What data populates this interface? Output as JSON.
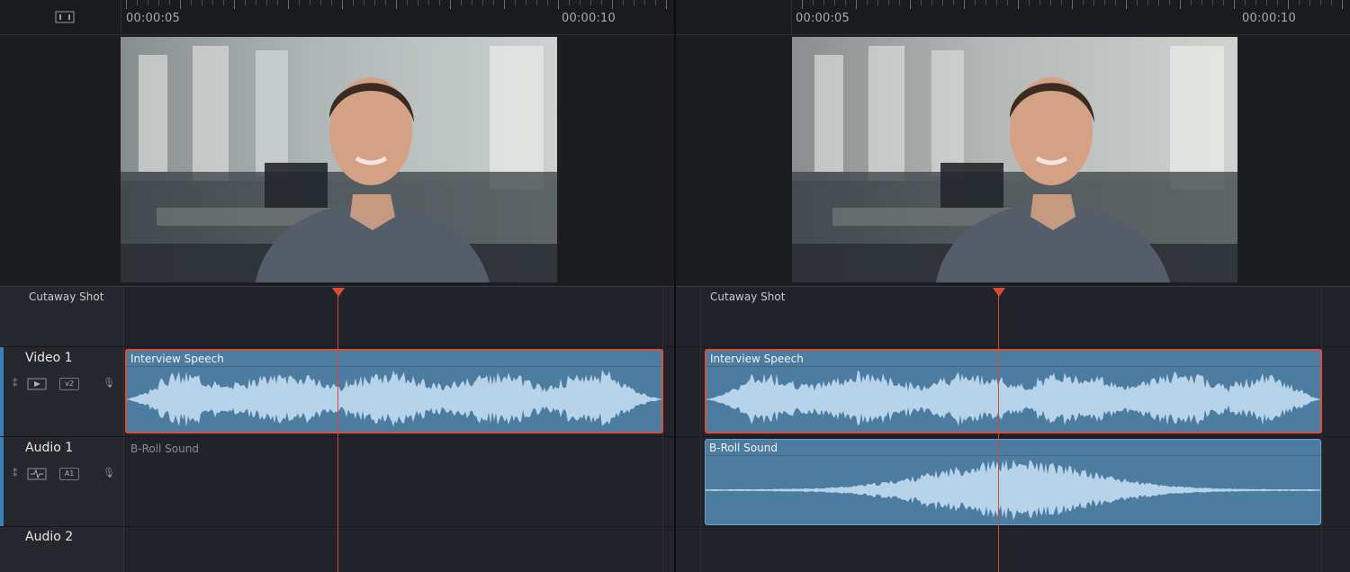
{
  "ruler": {
    "timecodes": [
      "00:00:05",
      "00:00:10"
    ],
    "icon": "viewer-toggle-icon"
  },
  "tracks": {
    "cutaway": "Cutaway Shot",
    "video1": "Video 1",
    "audio1": "Audio 1",
    "audio2": "Audio 2"
  },
  "clips": {
    "interview": "Interview Speech",
    "broll": "B-Roll Sound"
  },
  "track_controls": {
    "video1_toggle": "v2",
    "audio1_toggle": "A1"
  },
  "colors": {
    "clip_fill": "#4d7ca1",
    "selected_border": "#d8513d",
    "playhead": "#d2483a",
    "waveform": "#b7d3e9"
  }
}
